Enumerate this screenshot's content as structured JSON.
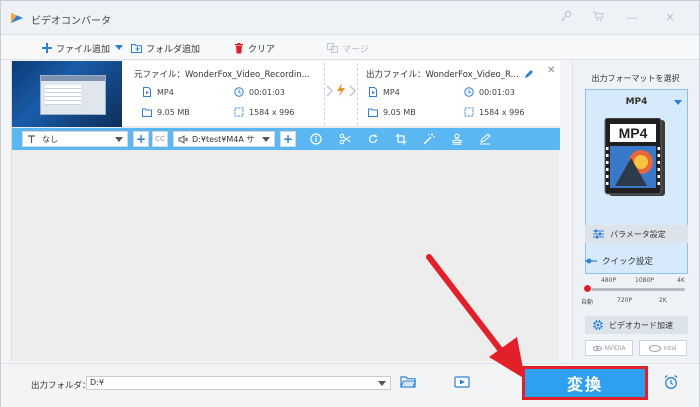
{
  "window": {
    "title": "ビデオコンバータ"
  },
  "toolbar": {
    "add_file": "ファイル追加",
    "add_folder": "フォルダ追加",
    "clear": "クリア",
    "merge": "マージ"
  },
  "task": {
    "source": {
      "label": "元ファイル：",
      "filename": "WonderFox_Video_Recordin...",
      "format": "MP4",
      "duration": "00:01:03",
      "size": "9.05 MB",
      "resolution": "1584 x 996"
    },
    "output": {
      "label": "出力ファイル：",
      "filename": "WonderFox_Video_R...",
      "format": "MP4",
      "duration": "00:01:03",
      "size": "9.05 MB",
      "resolution": "1584 x 996"
    }
  },
  "edit_bar": {
    "subtitle_select": "なし",
    "cc_label": "CC",
    "audio_select": "D:¥test¥M4A サ"
  },
  "bottom": {
    "output_folder_label": "出力フォルダ：",
    "output_folder_value": "D:¥",
    "convert_label": "変換"
  },
  "right_panel": {
    "title": "出力フォーマットを選択",
    "format": "MP4",
    "format_icon_text": "MP4",
    "parameter_settings": "パラメータ設定",
    "quick_settings": "クイック設定",
    "quality_top": [
      "480P",
      "1080P",
      "4K"
    ],
    "quality_bottom": [
      "自動",
      "720P",
      "2K"
    ],
    "quality_value": "自動",
    "gpu_accel": "ビデオカード加速",
    "vendor_nvidia": "NVIDIA",
    "vendor_intel": "intel"
  },
  "colors": {
    "accent": "#2fa0f0",
    "edit_bar": "#5bb7f1",
    "highlight_red": "#e2202a"
  }
}
